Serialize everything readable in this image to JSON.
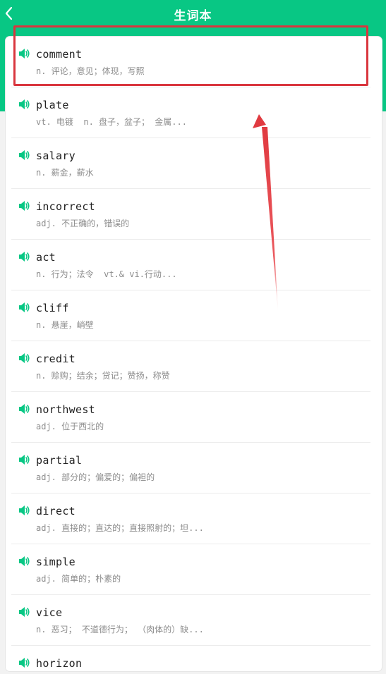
{
  "header": {
    "title": "生词本",
    "back_icon": "chevron-left-icon",
    "color": "#08c784"
  },
  "word_list": {
    "speaker_icon": "speaker-icon",
    "speaker_color": "#08c784",
    "items": [
      {
        "word": "comment",
        "meaning": "n. 评论，意见；体现，写照"
      },
      {
        "word": "plate",
        "meaning": "vt. 电镀  n. 盘子，盆子； 金属..."
      },
      {
        "word": "salary",
        "meaning": "n. 薪金，薪水"
      },
      {
        "word": "incorrect",
        "meaning": "adj. 不正确的，错误的"
      },
      {
        "word": "act",
        "meaning": "n. 行为；法令  vt.& vi.行动..."
      },
      {
        "word": "cliff",
        "meaning": "n. 悬崖，峭壁"
      },
      {
        "word": "credit",
        "meaning": "n. 赊购；结余；贷记；赞扬，称赞"
      },
      {
        "word": "northwest",
        "meaning": "adj. 位于西北的"
      },
      {
        "word": "partial",
        "meaning": "adj. 部分的；偏爱的；偏袒的"
      },
      {
        "word": "direct",
        "meaning": "adj. 直接的；直达的；直接照射的；坦..."
      },
      {
        "word": "simple",
        "meaning": "adj. 简单的；朴素的"
      },
      {
        "word": "vice",
        "meaning": "n. 恶习； 不道德行为； （肉体的）缺..."
      },
      {
        "word": "horizon",
        "meaning": ""
      }
    ]
  },
  "annotation": {
    "highlight_color": "#d9363e"
  }
}
